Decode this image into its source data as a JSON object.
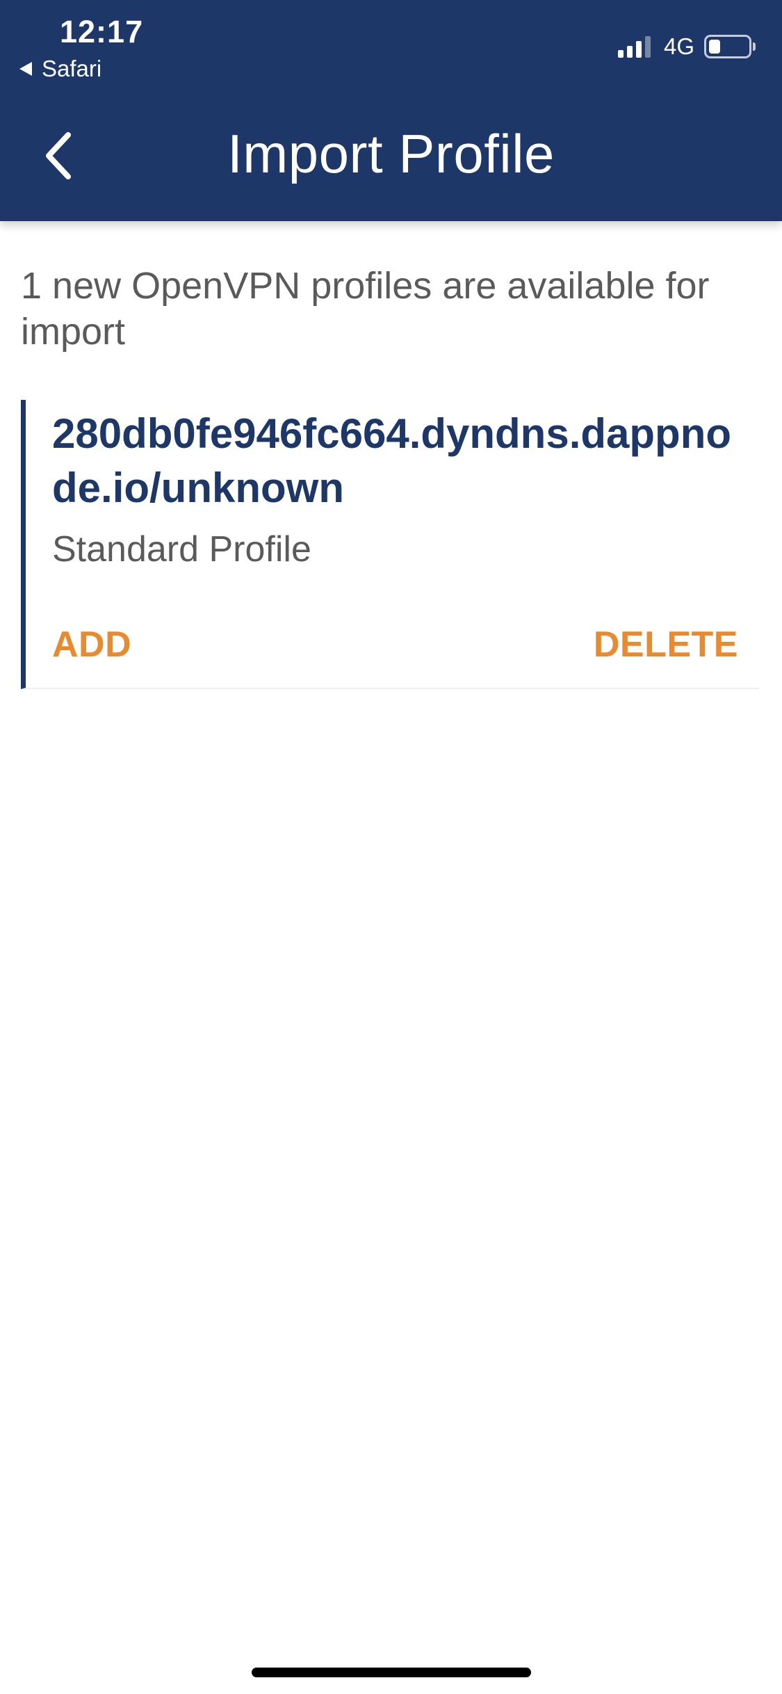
{
  "status_bar": {
    "time": "12:17",
    "back_app": "Safari",
    "network": "4G",
    "battery_level": 0.3,
    "signal_bars_active": 3,
    "signal_bars_total": 4
  },
  "header": {
    "title": "Import Profile",
    "back_icon": "chevron-left-icon"
  },
  "main": {
    "intro_text": "1 new OpenVPN profiles are available for import",
    "profiles": [
      {
        "host": "280db0fe946fc664.dyndns.dappnode.io/unknown",
        "type": "Standard Profile",
        "add_label": "ADD",
        "delete_label": "DELETE"
      }
    ]
  },
  "colors": {
    "header_bg": "#1c3768",
    "accent": "#e98a2e",
    "title_text": "#1c3768",
    "body_text": "#5a5a5a"
  }
}
